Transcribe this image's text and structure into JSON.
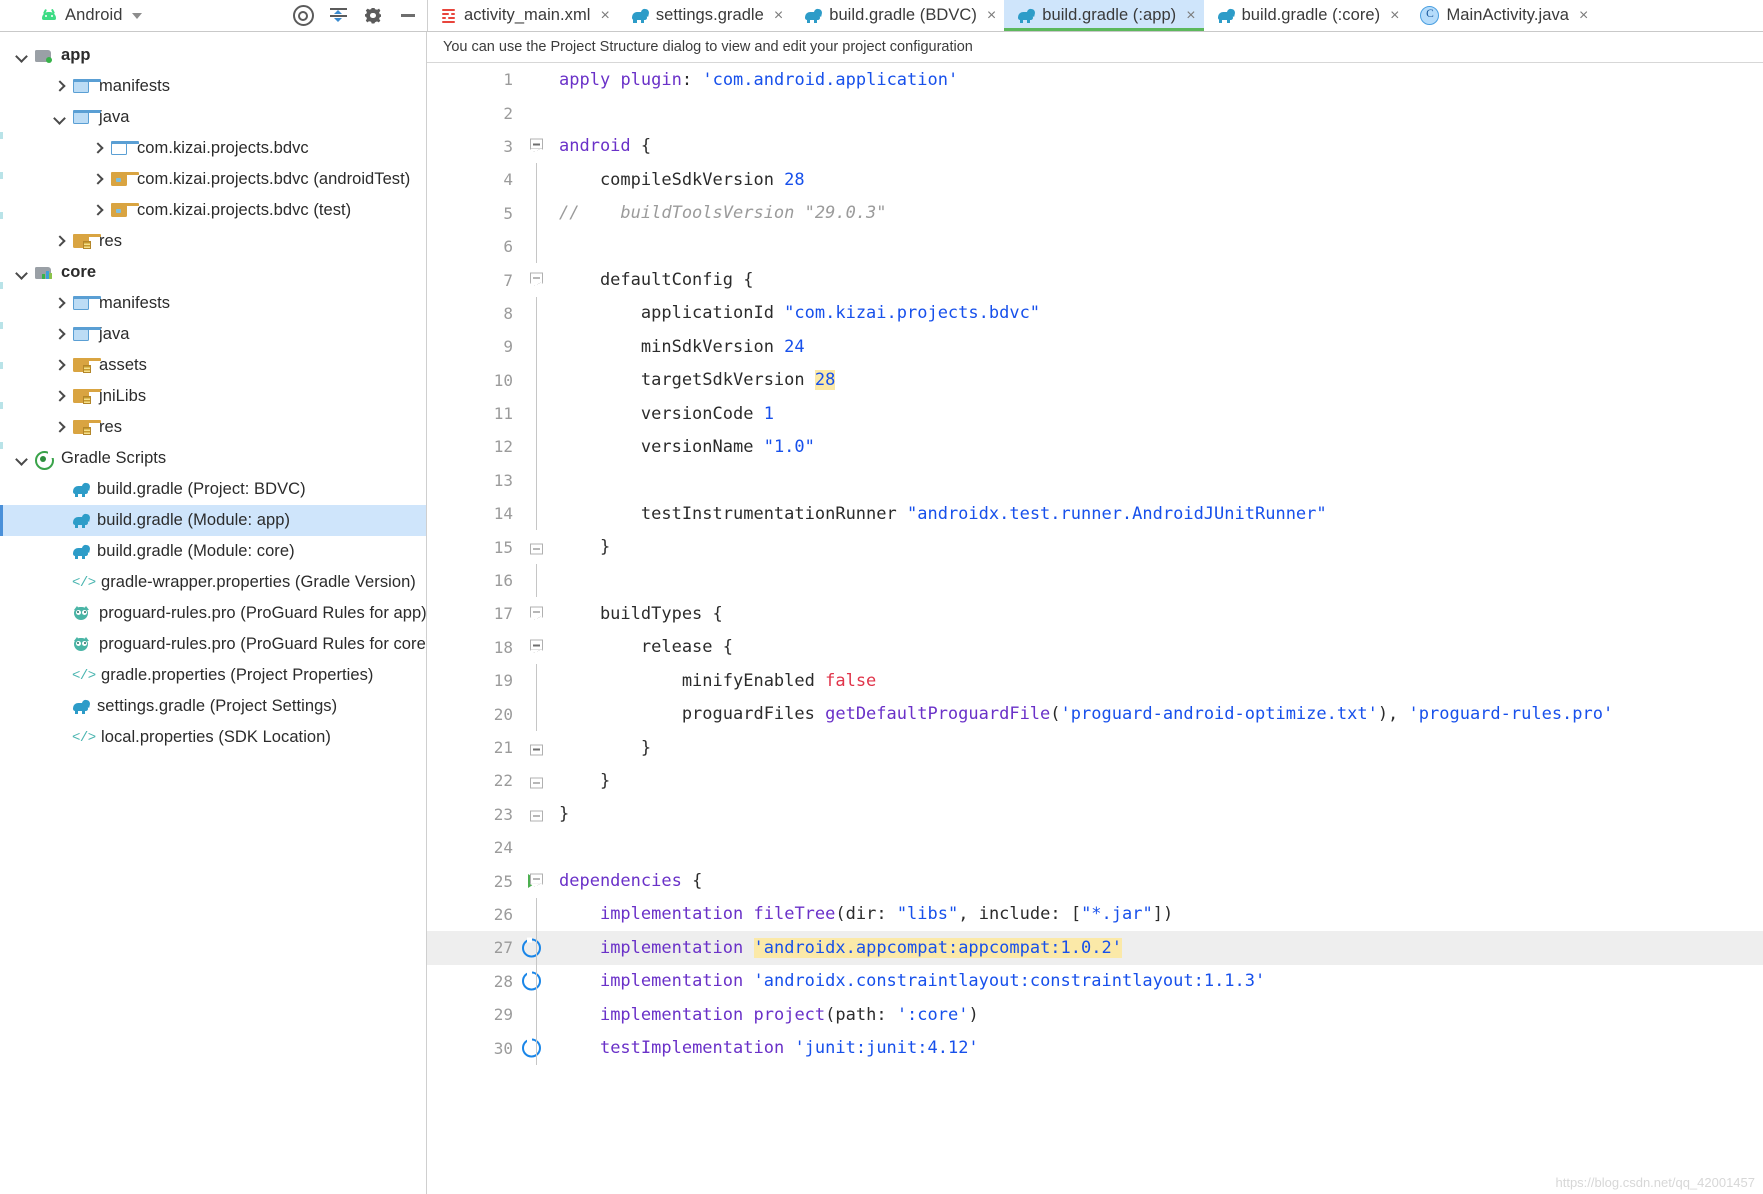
{
  "project_panel": {
    "title": "Android",
    "dropdown_icon": "chevron-down-icon",
    "android_icon": "android-robot-icon",
    "actions": [
      {
        "name": "select-opened-file-icon",
        "label": "Select Opened File"
      },
      {
        "name": "collapse-all-icon",
        "label": "Collapse All"
      },
      {
        "name": "settings-gear-icon",
        "label": "Settings"
      },
      {
        "name": "hide-panel-icon",
        "label": "Hide"
      }
    ],
    "tree": [
      {
        "label": "app",
        "icon": "module-icon",
        "arrow": "down",
        "indent": 0,
        "bold": true,
        "selected": false
      },
      {
        "label": "manifests",
        "icon": "folder-blue-icon",
        "arrow": "right",
        "indent": 1,
        "bold": false,
        "selected": false
      },
      {
        "label": "java",
        "icon": "folder-blue-icon",
        "arrow": "down",
        "indent": 1,
        "bold": false,
        "selected": false
      },
      {
        "label": "com.kizai.projects.bdvc",
        "icon": "folder-blue-outline-icon",
        "arrow": "right",
        "indent": 2,
        "bold": false,
        "selected": false
      },
      {
        "label": "com.kizai.projects.bdvc (androidTest)",
        "icon": "folder-test-icon",
        "arrow": "right",
        "indent": 2,
        "bold": false,
        "selected": false
      },
      {
        "label": "com.kizai.projects.bdvc (test)",
        "icon": "folder-test-icon",
        "arrow": "right",
        "indent": 2,
        "bold": false,
        "selected": false
      },
      {
        "label": "res",
        "icon": "folder-res-icon",
        "arrow": "right",
        "indent": 1,
        "bold": false,
        "selected": false
      },
      {
        "label": "core",
        "icon": "library-module-icon",
        "arrow": "down",
        "indent": 0,
        "bold": true,
        "selected": false
      },
      {
        "label": "manifests",
        "icon": "folder-blue-icon",
        "arrow": "right",
        "indent": 1,
        "bold": false,
        "selected": false
      },
      {
        "label": "java",
        "icon": "folder-blue-icon",
        "arrow": "right",
        "indent": 1,
        "bold": false,
        "selected": false
      },
      {
        "label": "assets",
        "icon": "folder-res-icon",
        "arrow": "right",
        "indent": 1,
        "bold": false,
        "selected": false
      },
      {
        "label": "jniLibs",
        "icon": "folder-res-icon",
        "arrow": "right",
        "indent": 1,
        "bold": false,
        "selected": false
      },
      {
        "label": "res",
        "icon": "folder-res-icon",
        "arrow": "right",
        "indent": 1,
        "bold": false,
        "selected": false
      },
      {
        "label": "Gradle Scripts",
        "icon": "gradle-scripts-icon",
        "arrow": "down",
        "indent": 0,
        "bold": false,
        "selected": false
      },
      {
        "label": "build.gradle (Project: BDVC)",
        "icon": "gradle-file-icon",
        "arrow": "none",
        "indent": 1,
        "bold": false,
        "selected": false
      },
      {
        "label": "build.gradle (Module: app)",
        "icon": "gradle-file-icon",
        "arrow": "none",
        "indent": 1,
        "bold": false,
        "selected": true
      },
      {
        "label": "build.gradle (Module: core)",
        "icon": "gradle-file-icon",
        "arrow": "none",
        "indent": 1,
        "bold": false,
        "selected": false
      },
      {
        "label": "gradle-wrapper.properties (Gradle Version)",
        "icon": "code-file-icon",
        "arrow": "none",
        "indent": 1,
        "bold": false,
        "selected": false
      },
      {
        "label": "proguard-rules.pro (ProGuard Rules for app)",
        "icon": "proguard-owl-icon",
        "arrow": "none",
        "indent": 1,
        "bold": false,
        "selected": false
      },
      {
        "label": "proguard-rules.pro (ProGuard Rules for core)",
        "icon": "proguard-owl-icon",
        "arrow": "none",
        "indent": 1,
        "bold": false,
        "selected": false
      },
      {
        "label": "gradle.properties (Project Properties)",
        "icon": "code-file-icon",
        "arrow": "none",
        "indent": 1,
        "bold": false,
        "selected": false
      },
      {
        "label": "settings.gradle (Project Settings)",
        "icon": "gradle-file-icon",
        "arrow": "none",
        "indent": 1,
        "bold": false,
        "selected": false
      },
      {
        "label": "local.properties (SDK Location)",
        "icon": "code-file-icon",
        "arrow": "none",
        "indent": 1,
        "bold": false,
        "selected": false
      }
    ]
  },
  "editor": {
    "tabs": [
      {
        "label": "activity_main.xml",
        "icon": "xml-layout-icon",
        "active": false,
        "closable": true
      },
      {
        "label": "settings.gradle",
        "icon": "gradle-file-icon",
        "active": false,
        "closable": true
      },
      {
        "label": "build.gradle (BDVC)",
        "icon": "gradle-file-icon",
        "active": false,
        "closable": true
      },
      {
        "label": "build.gradle (:app)",
        "icon": "gradle-file-icon",
        "active": true,
        "closable": true
      },
      {
        "label": "build.gradle (:core)",
        "icon": "gradle-file-icon",
        "active": false,
        "closable": true
      },
      {
        "label": "MainActivity.java",
        "icon": "java-class-icon",
        "active": false,
        "closable": true
      }
    ],
    "close_glyph": "×",
    "notification": "You can use the Project Structure dialog to view and edit your project configuration",
    "watermark": "https://blog.csdn.net/qq_42001457",
    "current_line": 27,
    "lines": [
      {
        "n": 1,
        "fold": "none",
        "gutter_icon": "none",
        "text": "apply plugin: 'com.android.application'"
      },
      {
        "n": 2,
        "fold": "none",
        "gutter_icon": "none",
        "text": ""
      },
      {
        "n": 3,
        "fold": "start",
        "gutter_icon": "none",
        "text": "android {"
      },
      {
        "n": 4,
        "fold": "line",
        "gutter_icon": "none",
        "text": "    compileSdkVersion 28"
      },
      {
        "n": 5,
        "fold": "line",
        "gutter_icon": "none",
        "text": "//    buildToolsVersion \"29.0.3\""
      },
      {
        "n": 6,
        "fold": "line",
        "gutter_icon": "none",
        "text": ""
      },
      {
        "n": 7,
        "fold": "start",
        "gutter_icon": "none",
        "text": "    defaultConfig {"
      },
      {
        "n": 8,
        "fold": "line",
        "gutter_icon": "none",
        "text": "        applicationId \"com.kizai.projects.bdvc\""
      },
      {
        "n": 9,
        "fold": "line",
        "gutter_icon": "none",
        "text": "        minSdkVersion 24"
      },
      {
        "n": 10,
        "fold": "line",
        "gutter_icon": "none",
        "text": "        targetSdkVersion 28"
      },
      {
        "n": 11,
        "fold": "line",
        "gutter_icon": "none",
        "text": "        versionCode 1"
      },
      {
        "n": 12,
        "fold": "line",
        "gutter_icon": "none",
        "text": "        versionName \"1.0\""
      },
      {
        "n": 13,
        "fold": "line",
        "gutter_icon": "none",
        "text": ""
      },
      {
        "n": 14,
        "fold": "line",
        "gutter_icon": "none",
        "text": "        testInstrumentationRunner \"androidx.test.runner.AndroidJUnitRunner\""
      },
      {
        "n": 15,
        "fold": "end",
        "gutter_icon": "none",
        "text": "    }"
      },
      {
        "n": 16,
        "fold": "line",
        "gutter_icon": "none",
        "text": ""
      },
      {
        "n": 17,
        "fold": "start",
        "gutter_icon": "none",
        "text": "    buildTypes {"
      },
      {
        "n": 18,
        "fold": "start",
        "gutter_icon": "none",
        "text": "        release {"
      },
      {
        "n": 19,
        "fold": "line",
        "gutter_icon": "none",
        "text": "            minifyEnabled false"
      },
      {
        "n": 20,
        "fold": "line",
        "gutter_icon": "none",
        "text": "            proguardFiles getDefaultProguardFile('proguard-android-optimize.txt'), 'proguard-rules.pro'"
      },
      {
        "n": 21,
        "fold": "end",
        "gutter_icon": "none",
        "text": "        }"
      },
      {
        "n": 22,
        "fold": "end",
        "gutter_icon": "none",
        "text": "    }"
      },
      {
        "n": 23,
        "fold": "end",
        "gutter_icon": "none",
        "text": "}"
      },
      {
        "n": 24,
        "fold": "none",
        "gutter_icon": "none",
        "text": ""
      },
      {
        "n": 25,
        "fold": "start",
        "gutter_icon": "run",
        "text": "dependencies {"
      },
      {
        "n": 26,
        "fold": "line",
        "gutter_icon": "none",
        "text": "    implementation fileTree(dir: \"libs\", include: [\"*.jar\"])"
      },
      {
        "n": 27,
        "fold": "line",
        "gutter_icon": "dependency",
        "text": "    implementation 'androidx.appcompat:appcompat:1.0.2'"
      },
      {
        "n": 28,
        "fold": "line",
        "gutter_icon": "dependency",
        "text": "    implementation 'androidx.constraintlayout:constraintlayout:1.1.3'"
      },
      {
        "n": 29,
        "fold": "line",
        "gutter_icon": "none",
        "text": "    implementation project(path: ':core')"
      },
      {
        "n": 30,
        "fold": "line",
        "gutter_icon": "dependency",
        "text": "    testImplementation 'junit:junit:4.12'"
      }
    ],
    "highlights": [
      {
        "line": 10,
        "text": "28"
      },
      {
        "line": 27,
        "text": "'androidx.appcompat:appcompat:1.0.2'"
      }
    ]
  },
  "colors": {
    "keyword": "#6a31c8",
    "string": "#1750eb",
    "number": "#1750eb",
    "comment": "#9b9b9b",
    "boolean": "#e0344a",
    "selection": "#cfe5fb",
    "search_highlight": "#fbe9a8",
    "current_line": "#eeeeee",
    "active_tab_underline": "#5cb85c"
  }
}
